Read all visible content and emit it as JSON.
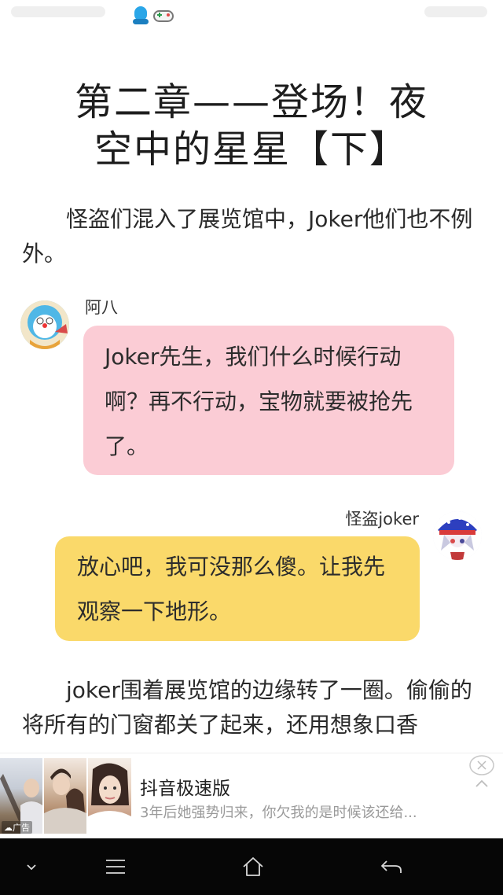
{
  "reader": {
    "chapter_title_line1": "第二章——登场！夜",
    "chapter_title_line2": "空中的星星【下】",
    "paragraph_1": "怪盗们混入了展览馆中，Joker他们也不例外。",
    "dialog": [
      {
        "speaker": "阿八",
        "text": "Joker先生，我们什么时候行动啊？再不行动，宝物就要被抢先了。",
        "bubble_color": "#fbccd5"
      },
      {
        "speaker": "怪盗joker",
        "text": "放心吧，我可没那么傻。让我先观察一下地形。",
        "bubble_color": "#fad96a"
      }
    ],
    "paragraph_2": "joker围着展览馆的边缘转了一圈。偷偷的将所有的门窗都关了起来，还用想象口香"
  },
  "ad": {
    "badge": "广告",
    "title": "抖音极速版",
    "description": "3年后她强势归来，你欠我的是时候该还给..."
  },
  "status_bar": {
    "icons": [
      "qq-icon",
      "game-controller-icon"
    ]
  },
  "nav_bar": {
    "buttons": [
      "chevron-down-icon",
      "menu-icon",
      "home-icon",
      "back-icon"
    ]
  }
}
